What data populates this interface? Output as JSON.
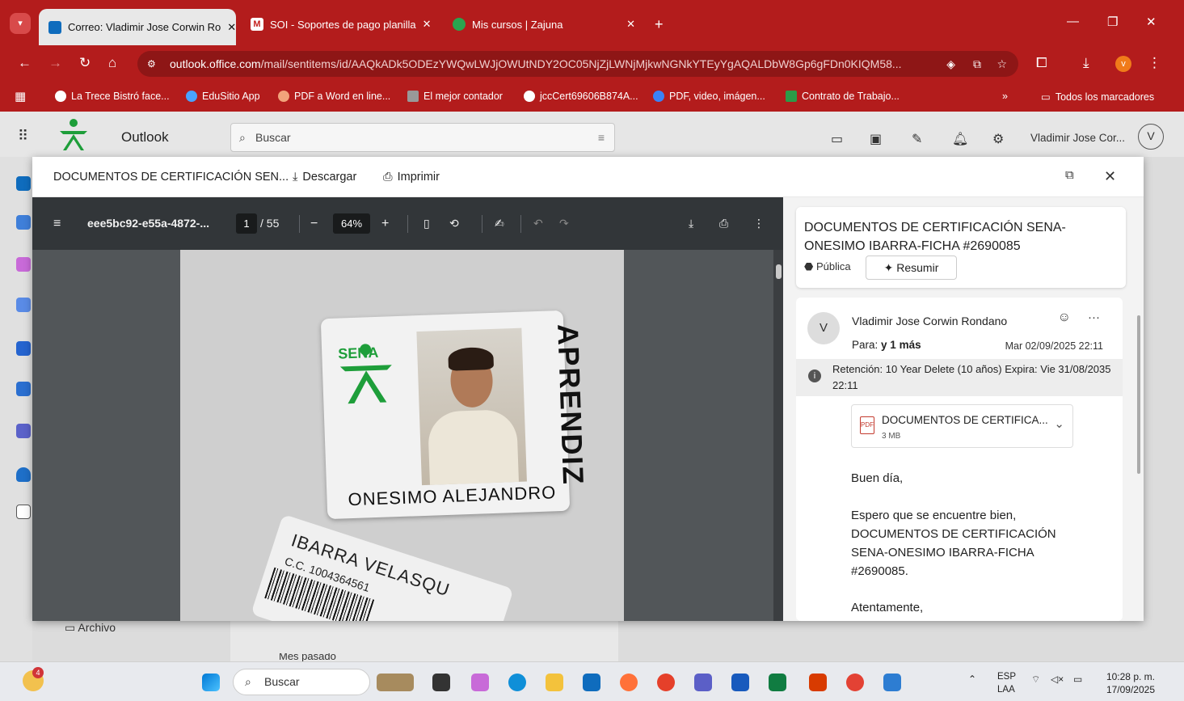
{
  "browser": {
    "tabs": [
      {
        "label": "Correo: Vladimir Jose Corwin Ro",
        "close": "✕"
      },
      {
        "label": "SOI - Soportes de pago planilla",
        "close": "✕"
      },
      {
        "label": "Mis cursos | Zajuna",
        "close": "✕"
      }
    ],
    "new_tab": "+",
    "url_host": "outlook.office.com",
    "url_path": "/mail/sentitems/id/AAQkADk5ODEzYWQwLWJjOWUtNDY2OC05NjZjLWNjMjkwNGNkYTEyYgAQALDbW8Gp6gFDn0KIQM58...",
    "bookmarks": [
      "La Trece Bistró face...",
      "EduSitio App",
      "PDF a Word en line...",
      "El mejor contador",
      "jccCert69606B874A...",
      "PDF, video, imágen...",
      "Contrato de Trabajo..."
    ],
    "bookmarks_more": "»",
    "all_bookmarks": "Todos los marcadores"
  },
  "outlook": {
    "app_name": "Outlook",
    "search_placeholder": "Buscar",
    "user_name": "Vladimir Jose Cor...",
    "avatar_initial": "V",
    "folder_archivo": "Archivo",
    "list_group": "Mes pasado"
  },
  "viewer": {
    "title": "DOCUMENTOS DE CERTIFICACIÓN SEN...",
    "download": "Descargar",
    "print": "Imprimir"
  },
  "pdf": {
    "filename": "eee5bc92-e55a-4872-...",
    "page": "1",
    "page_total": "/ 55",
    "zoom": "64%",
    "minus": "−",
    "plus": "+",
    "card_text_1": "APRENDIZ",
    "card_text_2": "ONESIMO ALEJANDRO",
    "card_brand": "SENA",
    "card2_name": "IBARRA VELASQU",
    "card2_cc": "C.C. 1004364561"
  },
  "email": {
    "subject": "DOCUMENTOS DE CERTIFICACIÓN SENA-ONESIMO IBARRA-FICHA #2690085",
    "visibility": "Pública",
    "summarize": "Resumir",
    "sender": "Vladimir Jose Corwin Rondano",
    "sender_initial": "V",
    "to_label": "Para:",
    "to_value": "y 1 más",
    "date": "Mar 02/09/2025 22:11",
    "retention": "Retención: 10 Year Delete (10 años) Expira: Vie 31/08/2035 22:11",
    "attachment_name": "DOCUMENTOS DE CERTIFICA...",
    "attachment_size": "3 MB",
    "body_greeting": "Buen día,",
    "body_text": "Espero que se encuentre bien, DOCUMENTOS DE CERTIFICACIÓN SENA-ONESIMO IBARRA-FICHA #2690085.",
    "body_closing": "Atentamente,"
  },
  "taskbar": {
    "search": "Buscar",
    "lang_1": "ESP",
    "lang_2": "LAA",
    "time": "10:28 p. m.",
    "date": "17/09/2025",
    "notif_count": "4"
  },
  "colors": {
    "chrome_red": "#b31c1c",
    "sena_green": "#1e9e3a"
  }
}
